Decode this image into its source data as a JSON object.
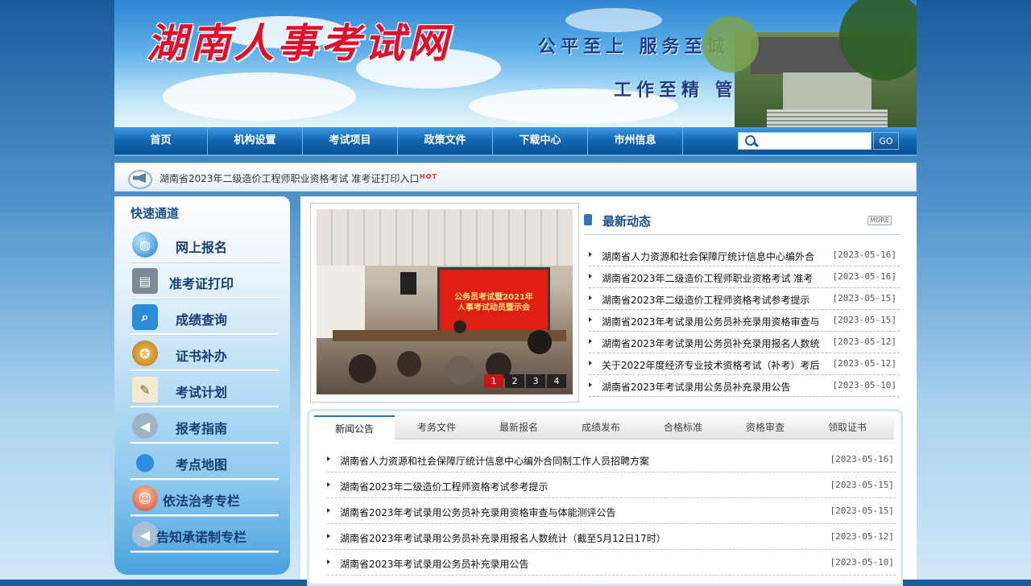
{
  "banner": {
    "title": "湖南人事考试网",
    "slogan_top": "公平至上  服务至诚",
    "slogan_bottom": "工作至精  管理至严"
  },
  "nav": {
    "items": [
      "首页",
      "机构设置",
      "考试项目",
      "政策文件",
      "下载中心",
      "市州信息"
    ],
    "search_placeholder": "",
    "go_label": "GO"
  },
  "notice": {
    "text": "湖南省2023年二级造价工程师职业资格考试  准考证打印入口",
    "badge": "HOT"
  },
  "sidebar": {
    "title": "快速通道",
    "items": [
      {
        "label": "网上报名",
        "icon": "globe-icon"
      },
      {
        "label": "准考证打印",
        "icon": "printer-icon"
      },
      {
        "label": "成绩查询",
        "icon": "magnifier-icon"
      },
      {
        "label": "证书补办",
        "icon": "certificate-icon"
      },
      {
        "label": "考试计划",
        "icon": "notepad-icon"
      },
      {
        "label": "报考指南",
        "icon": "megaphone-icon"
      },
      {
        "label": "考点地图",
        "icon": "map-pin-icon"
      },
      {
        "label": "依法治考专栏",
        "icon": "person-icon"
      },
      {
        "label": "告知承诺制专栏",
        "icon": "megaphone-icon"
      }
    ]
  },
  "slideshow": {
    "screen_text_1": "公务员考试暨2021年",
    "screen_text_2": "人事考试动员暨示会",
    "pages": [
      "1",
      "2",
      "3",
      "4"
    ],
    "active_page": "1"
  },
  "latest": {
    "title": "最新动态",
    "more_label": "MORE",
    "items": [
      {
        "text": "湖南省人力资源和社会保障厅统计信息中心编外合",
        "date": "[2023-05-16]"
      },
      {
        "text": "湖南省2023年二级造价工程师职业资格考试 准考",
        "date": "[2023-05-16]"
      },
      {
        "text": "湖南省2023年二级造价工程师资格考试参考提示",
        "date": "[2023-05-15]"
      },
      {
        "text": "湖南省2023年考试录用公务员补充录用资格审查与",
        "date": "[2023-05-15]"
      },
      {
        "text": "湖南省2023年考试录用公务员补充录用报名人数统",
        "date": "[2023-05-12]"
      },
      {
        "text": "关于2022年度经济专业技术资格考试（补考）考后",
        "date": "[2023-05-12]"
      },
      {
        "text": "湖南省2023年考试录用公务员补充录用公告",
        "date": "[2023-05-10]"
      }
    ]
  },
  "tabs": {
    "items": [
      "新闻公告",
      "考务文件",
      "最新报名",
      "成绩发布",
      "合格标准",
      "资格审查",
      "领取证书"
    ],
    "active": "新闻公告",
    "list": [
      {
        "text": "湖南省人力资源和社会保障厅统计信息中心编外合同制工作人员招聘方案",
        "date": "[2023-05-16]"
      },
      {
        "text": "湖南省2023年二级造价工程师资格考试参考提示",
        "date": "[2023-05-15]"
      },
      {
        "text": "湖南省2023年考试录用公务员补充录用资格审查与体能测评公告",
        "date": "[2023-05-15]"
      },
      {
        "text": "湖南省2023年考试录用公务员补充录用报名人数统计（截至5月12日17时）",
        "date": "[2023-05-12]"
      },
      {
        "text": "湖南省2023年考试录用公务员补充录用公告",
        "date": "[2023-05-10]"
      }
    ]
  }
}
